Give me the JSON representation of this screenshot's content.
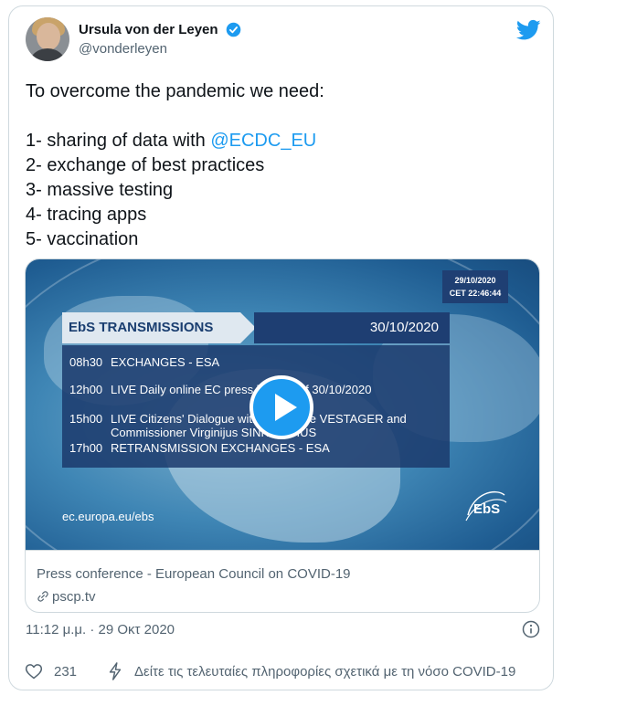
{
  "author": {
    "name": "Ursula von der Leyen",
    "handle": "@vonderleyen",
    "verified": true
  },
  "tweet": {
    "line1": "To overcome the pandemic we need:",
    "line3_prefix": "1- sharing of data with ",
    "line3_mention": "@ECDC_EU",
    "line4": "2- exchange of best practices",
    "line5": "3- massive testing",
    "line6": "4- tracing apps",
    "line7": "5- vaccination"
  },
  "video": {
    "date_top": "29/10/2020",
    "time_top": "CET 22:46:44",
    "header_left": "EbS TRANSMISSIONS",
    "header_right": "30/10/2020",
    "schedule": [
      {
        "time": "08h30",
        "text": "EXCHANGES - ESA"
      },
      {
        "time": "12h00",
        "text": "LIVE Daily online EC press briefing of 30/10/2020"
      },
      {
        "time": "15h00",
        "text": "LIVE Citizens' Dialogue with Margrethe  VESTAGER and"
      },
      {
        "time": "",
        "text": "Commissioner Virginijus SINKEVIČIUS"
      },
      {
        "time": "17h00",
        "text": "RETRANSMISSION EXCHANGES - ESA"
      }
    ],
    "url": "ec.europa.eu/ebs",
    "logo_text": "EbS"
  },
  "link_card": {
    "title": "Press conference - European Council on COVID-19",
    "domain": "pscp.tv"
  },
  "timestamp": "11:12 μ.μ. · 29 Οκτ 2020",
  "actions": {
    "like_count": "231",
    "covid_info": "Δείτε τις τελευταίες πληροφορίες σχετικά με τη νόσο COVID-19"
  },
  "colors": {
    "accent": "#1d9bf0",
    "secondary_text": "#536471",
    "border": "#cfd9de"
  }
}
